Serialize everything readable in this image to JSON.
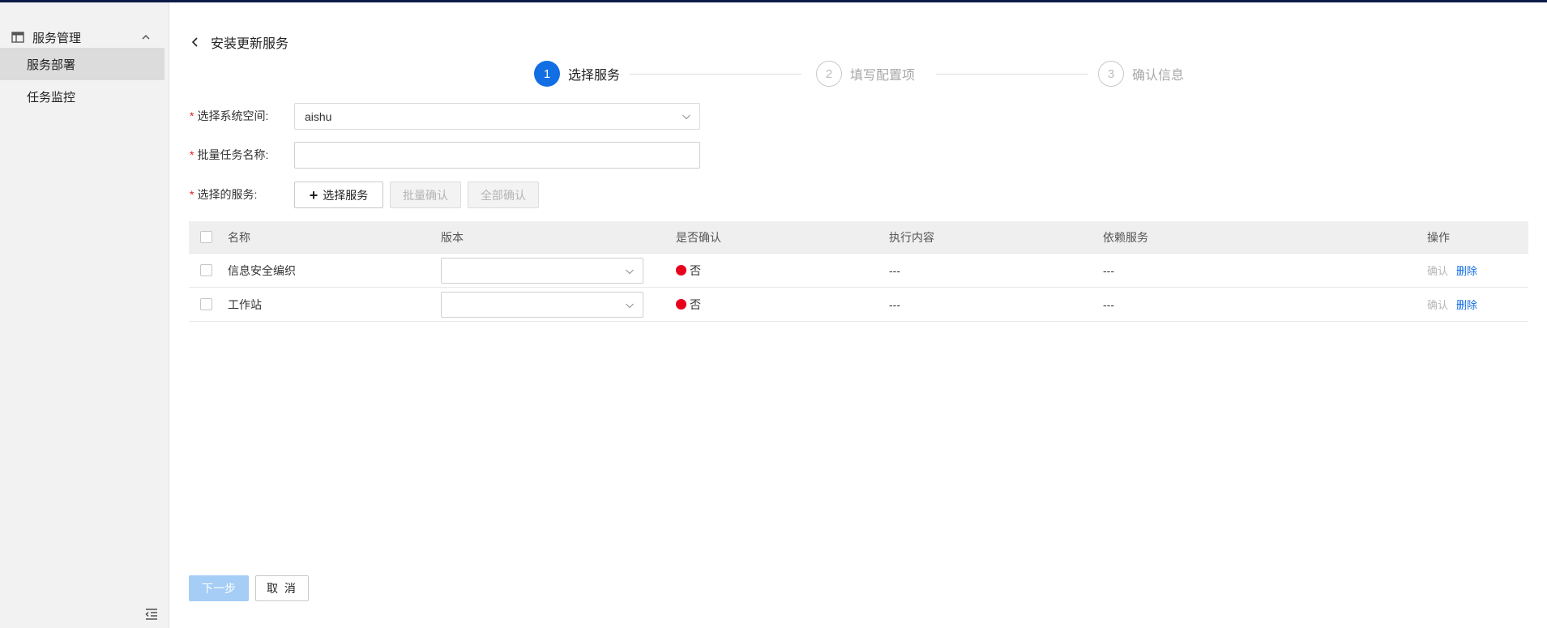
{
  "sidebar": {
    "group_label": "服务管理",
    "group_icon": "table-icon",
    "items": [
      {
        "label": "服务部署",
        "active": true
      },
      {
        "label": "任务监控",
        "active": false
      }
    ],
    "collapse_icon": "menu-collapse-icon"
  },
  "page": {
    "title": "安装更新服务",
    "back_icon": "chevron-left-icon"
  },
  "steps": [
    {
      "number": "1",
      "label": "选择服务",
      "state": "current"
    },
    {
      "number": "2",
      "label": "填写配置项",
      "state": "pending"
    },
    {
      "number": "3",
      "label": "确认信息",
      "state": "pending"
    }
  ],
  "form": {
    "namespace": {
      "label": "选择系统空间:",
      "value": "aishu"
    },
    "task_name": {
      "label": "批量任务名称:",
      "value": ""
    },
    "services": {
      "label": "选择的服务:",
      "add_button": "选择服务",
      "batch_confirm_button": "批量确认",
      "confirm_all_button": "全部确认"
    },
    "required_mark": "*"
  },
  "table": {
    "columns": [
      "名称",
      "版本",
      "是否确认",
      "执行内容",
      "依赖服务",
      "操作"
    ],
    "rows": [
      {
        "name": "信息安全编织",
        "version": "",
        "confirmed": "否",
        "content": "---",
        "dependency": "---",
        "action_confirm": "确认",
        "action_delete": "删除"
      },
      {
        "name": "工作站",
        "version": "",
        "confirmed": "否",
        "content": "---",
        "dependency": "---",
        "action_confirm": "确认",
        "action_delete": "删除"
      }
    ]
  },
  "footer": {
    "next_button": "下一步",
    "cancel_button": "取 消"
  },
  "colors": {
    "primary": "#126ee3",
    "status_red": "#e8001c",
    "required": "#e02020",
    "next_disabled": "#a5cdf6"
  }
}
